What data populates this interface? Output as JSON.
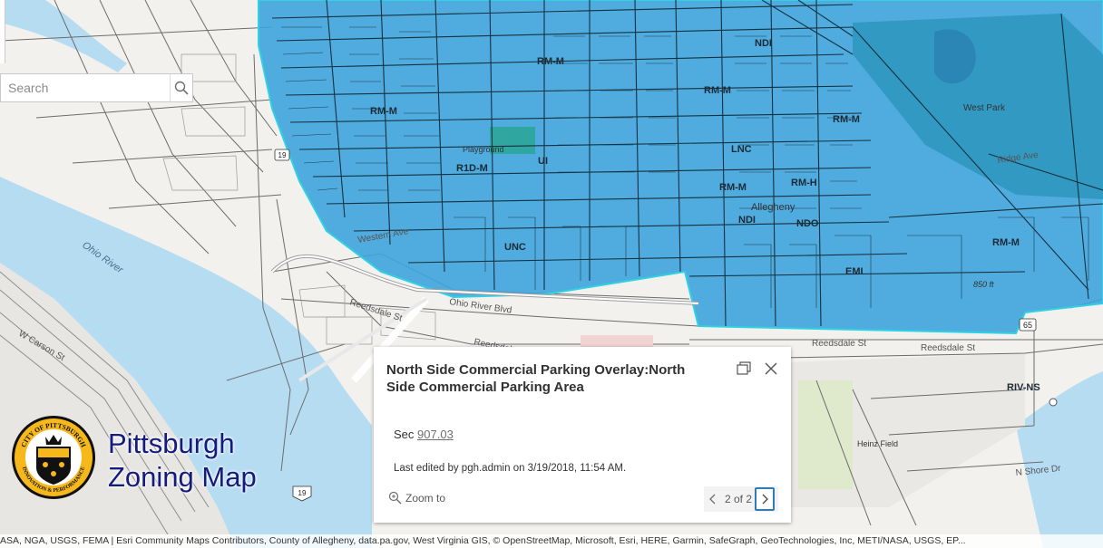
{
  "search": {
    "placeholder": "Search"
  },
  "title": {
    "line1": "Pittsburgh",
    "line2": "Zoning Map"
  },
  "logo": {
    "top_text": "CITY OF PITTSBURGH",
    "bottom_text": "INNOVATION & PERFORMANCE"
  },
  "popup": {
    "title": "North Side Commercial Parking Overlay:North Side Commercial Parking Area",
    "section_label": "Sec",
    "section_link": "907.03",
    "edited": "Last edited by pgh.admin on 3/19/2018, 11:54 AM.",
    "zoom_label": "Zoom to",
    "pager": "2 of 2"
  },
  "map": {
    "river_label": "Ohio River",
    "road_labels": {
      "ohio_river_blvd": "Ohio River Blvd",
      "reedsdale_1": "Reedsdale St",
      "reedsdale_2": "Reedsdale St",
      "reedsdale_3": "Reedsdale St",
      "reedsdale_4": "Reedsdale St",
      "western_ave": "Western Ave",
      "ridge_ave": "Ridge Ave",
      "n_shore": "N Shore Dr",
      "w_carson": "W Carson St",
      "allegheny": "Allegheny",
      "west_park": "West Park",
      "heinz_field": "Heinz Field",
      "playground": "Playground",
      "elevation": "850 ft"
    },
    "zone_labels": [
      "RM-M",
      "NDI",
      "RM-M",
      "RM-M",
      "UI",
      "RM-M",
      "R1D-M",
      "LNC",
      "RM-M",
      "RM-H",
      "NDI",
      "NDO",
      "UNC",
      "EMI",
      "RM-M",
      "RIV-NS"
    ],
    "route_shields": [
      "19",
      "65",
      "19"
    ],
    "colors": {
      "overlay_fill": "#3ea3db",
      "overlay_edge": "#2fd1e3",
      "water": "#b6dcf2",
      "land": "#f2f1ee"
    }
  },
  "attribution": "ASA, NGA, USGS, FEMA | Esri Community Maps Contributors, County of Allegheny, data.pa.gov, West Virginia GIS, © OpenStreetMap, Microsoft, Esri, HERE, Garmin, SafeGraph, GeoTechnologies, Inc, METI/NASA, USGS, EP..."
}
